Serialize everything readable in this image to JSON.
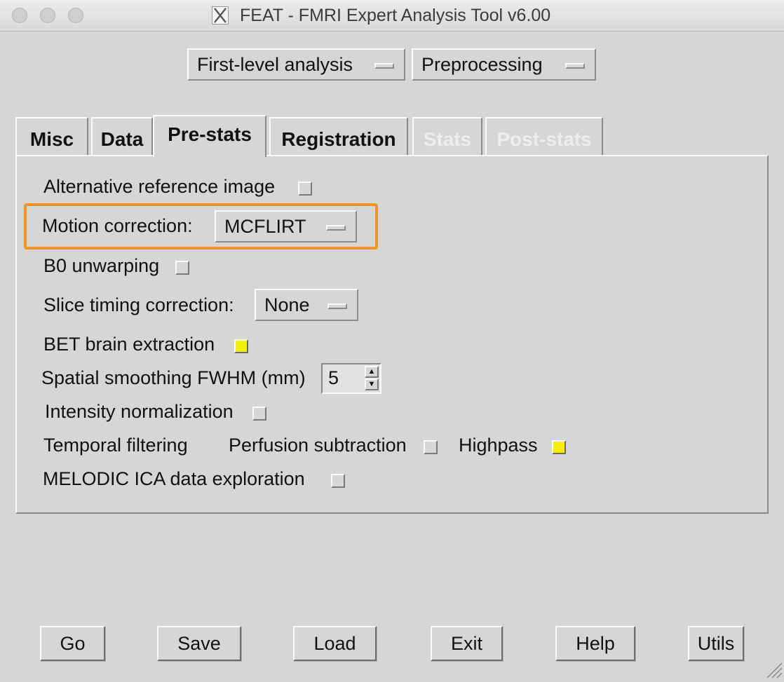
{
  "window": {
    "title": "FEAT - FMRI Expert Analysis Tool v6.00",
    "app_icon": "x11-icon"
  },
  "top_selectors": {
    "analysis_level": "First-level analysis",
    "analysis_mode": "Preprocessing"
  },
  "tabs": [
    {
      "label": "Misc",
      "state": "normal"
    },
    {
      "label": "Data",
      "state": "normal"
    },
    {
      "label": "Pre-stats",
      "state": "active"
    },
    {
      "label": "Registration",
      "state": "normal"
    },
    {
      "label": "Stats",
      "state": "disabled"
    },
    {
      "label": "Post-stats",
      "state": "disabled"
    }
  ],
  "prestats": {
    "alt_ref_label": "Alternative reference image",
    "alt_ref_checked": false,
    "motion_label": "Motion correction:",
    "motion_value": "MCFLIRT",
    "b0_label": "B0 unwarping",
    "b0_checked": false,
    "slice_timing_label": "Slice timing correction:",
    "slice_timing_value": "None",
    "bet_label": "BET brain extraction",
    "bet_checked": true,
    "smoothing_label": "Spatial smoothing FWHM (mm)",
    "smoothing_value": "5",
    "intensity_label": "Intensity normalization",
    "intensity_checked": false,
    "temporal_label": "Temporal filtering",
    "perfusion_label": "Perfusion subtraction",
    "perfusion_checked": false,
    "highpass_label": "Highpass",
    "highpass_checked": true,
    "melodic_label": "MELODIC ICA data exploration",
    "melodic_checked": false
  },
  "buttons": {
    "go": "Go",
    "save": "Save",
    "load": "Load",
    "exit": "Exit",
    "help": "Help",
    "utils": "Utils"
  },
  "colors": {
    "background": "#d6d6d6",
    "checked": "#f2f200",
    "highlight": "#f0951f",
    "disabled_text": "#ededed"
  }
}
